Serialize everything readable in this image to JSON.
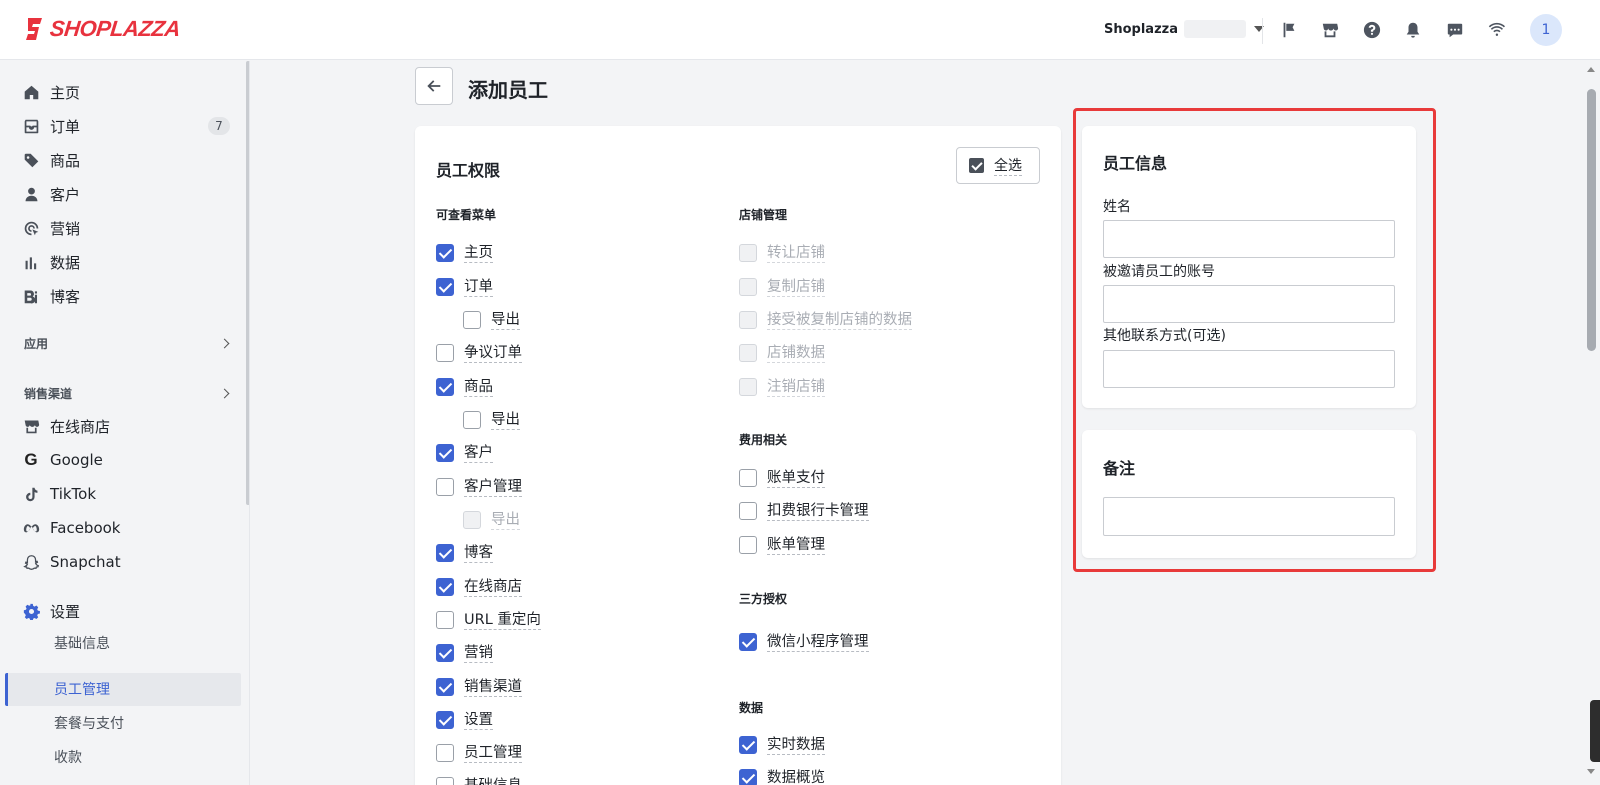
{
  "header": {
    "logo_text": "SHOPLAZZA",
    "store_name": "Shoplazza",
    "avatar_initial": "1",
    "icons": [
      "flag-icon",
      "store-icon",
      "help-icon",
      "bell-icon",
      "chat-icon",
      "wifi-icon"
    ]
  },
  "sidebar": {
    "main_items": [
      {
        "label": "主页",
        "icon": "home-icon"
      },
      {
        "label": "订单",
        "icon": "inbox-icon",
        "badge": "7"
      },
      {
        "label": "商品",
        "icon": "tag-icon"
      },
      {
        "label": "客户",
        "icon": "person-icon"
      },
      {
        "label": "营销",
        "icon": "marketing-icon"
      },
      {
        "label": "数据",
        "icon": "chart-icon"
      },
      {
        "label": "博客",
        "icon": "blog-icon"
      }
    ],
    "apps_section": "应用",
    "channels_section": "销售渠道",
    "channels": [
      {
        "label": "在线商店",
        "icon": "store-icon"
      },
      {
        "label": "Google",
        "icon": "google-icon"
      },
      {
        "label": "TikTok",
        "icon": "tiktok-icon"
      },
      {
        "label": "Facebook",
        "icon": "meta-icon"
      },
      {
        "label": "Snapchat",
        "icon": "snapchat-icon"
      }
    ],
    "settings": {
      "label": "设置",
      "icon": "gear-icon"
    },
    "settings_sub": [
      "基础信息",
      "员工管理",
      "套餐与支付",
      "收款"
    ],
    "active_sub": "员工管理"
  },
  "page": {
    "title": "添加员工",
    "back_icon": "arrow-left-icon"
  },
  "permissions": {
    "title": "员工权限",
    "select_all": "全选",
    "left_group_title": "可查看菜单",
    "left_items": [
      {
        "label": "主页",
        "checked": true
      },
      {
        "label": "订单",
        "checked": true
      },
      {
        "label": "导出",
        "checked": false,
        "indent": true
      },
      {
        "label": "争议订单",
        "checked": false
      },
      {
        "label": "商品",
        "checked": true
      },
      {
        "label": "导出",
        "checked": false,
        "indent": true
      },
      {
        "label": "客户",
        "checked": true
      },
      {
        "label": "客户管理",
        "checked": false
      },
      {
        "label": "导出",
        "checked": false,
        "indent": true,
        "disabled": true
      },
      {
        "label": "博客",
        "checked": true
      },
      {
        "label": "在线商店",
        "checked": true
      },
      {
        "label": "URL 重定向",
        "checked": false
      },
      {
        "label": "营销",
        "checked": true
      },
      {
        "label": "销售渠道",
        "checked": true
      },
      {
        "label": "设置",
        "checked": true
      },
      {
        "label": "员工管理",
        "checked": false
      },
      {
        "label": "基础信息",
        "checked": false
      }
    ],
    "store_group_title": "店铺管理",
    "store_items": [
      {
        "label": "转让店铺",
        "disabled": true
      },
      {
        "label": "复制店铺",
        "disabled": true
      },
      {
        "label": "接受被复制店铺的数据",
        "disabled": true
      },
      {
        "label": "店铺数据",
        "disabled": true
      },
      {
        "label": "注销店铺",
        "disabled": true
      }
    ],
    "fee_group_title": "费用相关",
    "fee_items": [
      {
        "label": "账单支付",
        "checked": false
      },
      {
        "label": "扣费银行卡管理",
        "checked": false
      },
      {
        "label": "账单管理",
        "checked": false
      }
    ],
    "auth_group_title": "三方授权",
    "auth_items": [
      {
        "label": "微信小程序管理",
        "checked": true
      }
    ],
    "data_group_title": "数据",
    "data_items": [
      {
        "label": "实时数据",
        "checked": true
      },
      {
        "label": "数据概览",
        "checked": true
      }
    ]
  },
  "staff_info": {
    "title": "员工信息",
    "name_label": "姓名",
    "name_value": "",
    "account_label": "被邀请员工的账号",
    "account_value": "",
    "contact_label": "其他联系方式(可选)",
    "contact_value": ""
  },
  "note": {
    "title": "备注",
    "value": ""
  },
  "colors": {
    "accent": "#3d63d2",
    "highlight": "#e83a3a",
    "brand": "#e8323e"
  }
}
